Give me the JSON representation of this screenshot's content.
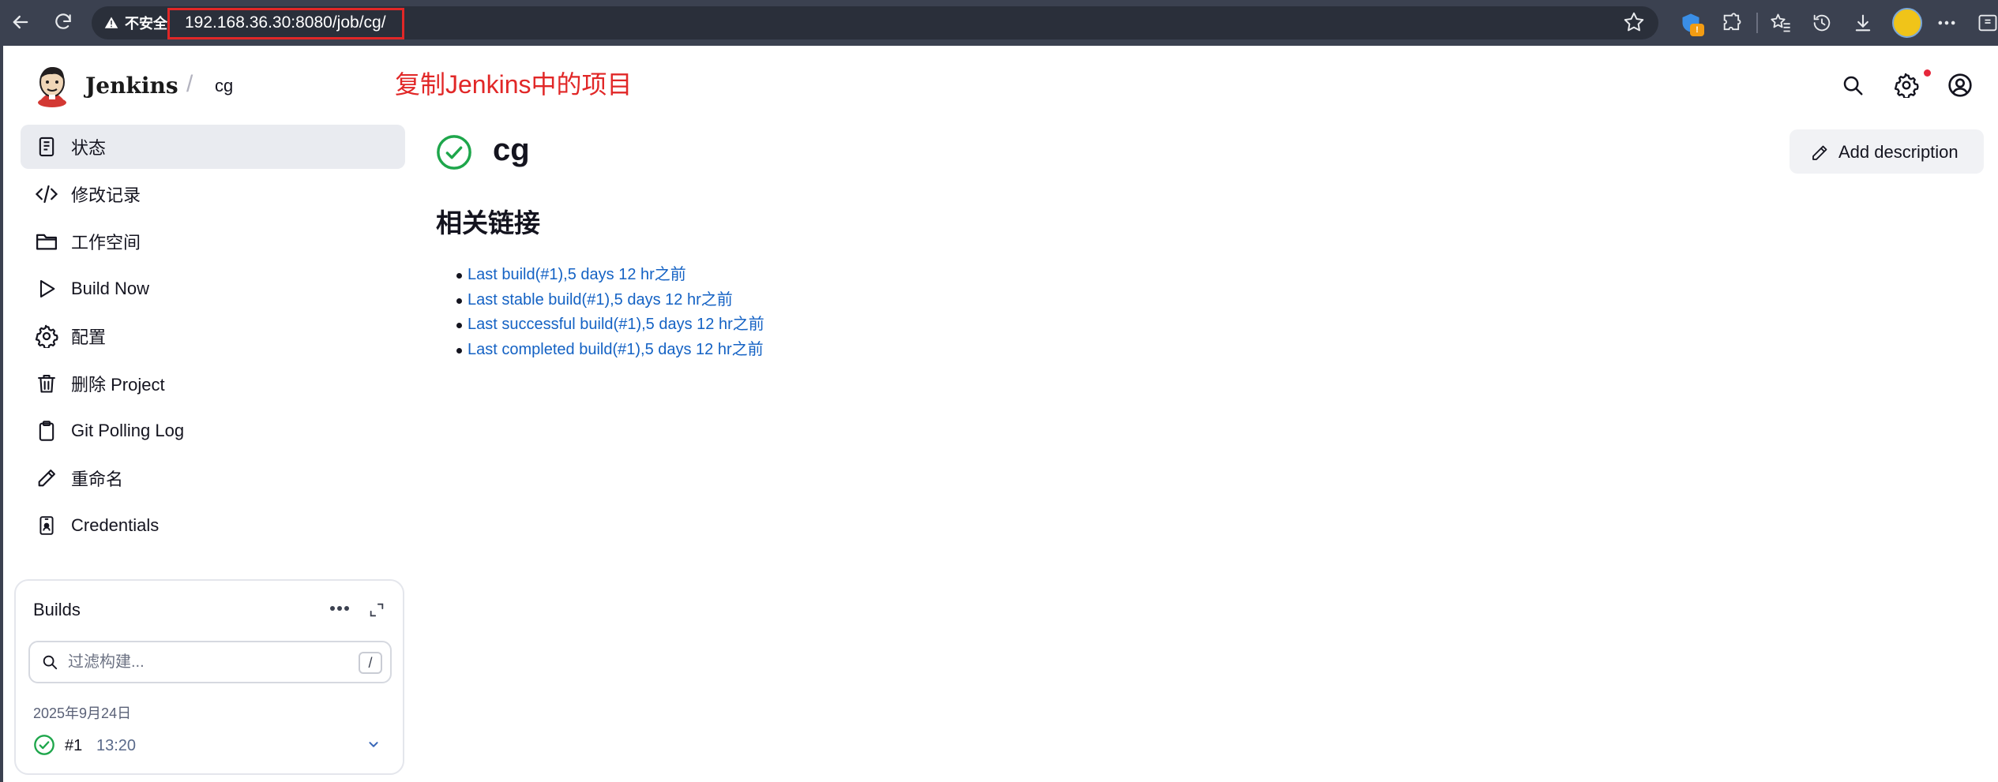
{
  "browser": {
    "security_label": "不安全",
    "url": "192.168.36.30:8080/job/cg/",
    "ext_badge": "!"
  },
  "header": {
    "brand": "Jenkins",
    "separator": "/",
    "breadcrumb_job": "cg",
    "annotation": "复制Jenkins中的项目"
  },
  "sidebar": {
    "items": [
      {
        "label": "状态",
        "icon": "status-doc-icon"
      },
      {
        "label": "修改记录",
        "icon": "code-icon"
      },
      {
        "label": "工作空间",
        "icon": "folder-icon"
      },
      {
        "label": "Build Now",
        "icon": "play-icon"
      },
      {
        "label": "配置",
        "icon": "gear-icon"
      },
      {
        "label": "删除 Project",
        "icon": "trash-icon"
      },
      {
        "label": "Git Polling Log",
        "icon": "clipboard-icon"
      },
      {
        "label": "重命名",
        "icon": "pencil-icon"
      },
      {
        "label": "Credentials",
        "icon": "credentials-icon"
      }
    ]
  },
  "builds": {
    "title": "Builds",
    "filter_placeholder": "过滤构建...",
    "shortcut_key": "/",
    "date": "2025年9月24日",
    "entries": [
      {
        "number": "#1",
        "time": "13:20",
        "status": "success"
      }
    ]
  },
  "main": {
    "job_name": "cg",
    "add_description": "Add description",
    "section_title": "相关链接",
    "links": [
      "Last build(#1),5 days 12 hr之前",
      "Last stable build(#1),5 days 12 hr之前",
      "Last successful build(#1),5 days 12 hr之前",
      "Last completed build(#1),5 days 12 hr之前"
    ]
  },
  "colors": {
    "success": "#1ea64b",
    "link": "#1462c4",
    "annotation": "#e12727",
    "browser_bar": "#3b4150"
  }
}
